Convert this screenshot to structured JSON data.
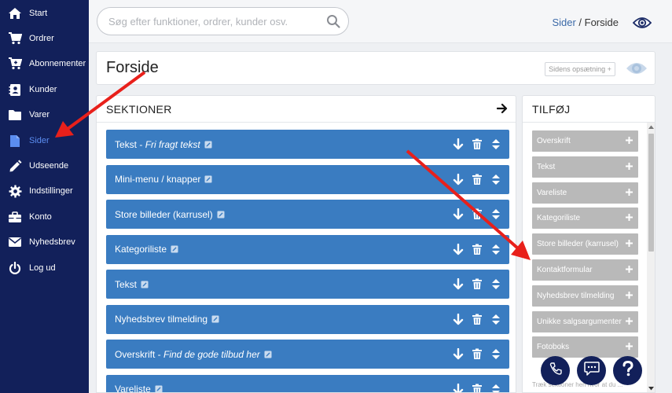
{
  "sidebar": {
    "items": [
      {
        "label": "Start",
        "icon": "home-icon"
      },
      {
        "label": "Ordrer",
        "icon": "cart-icon"
      },
      {
        "label": "Abonnementer",
        "icon": "cart-plus-icon"
      },
      {
        "label": "Kunder",
        "icon": "address-book-icon"
      },
      {
        "label": "Varer",
        "icon": "folder-icon"
      },
      {
        "label": "Sider",
        "icon": "file-icon",
        "active": true
      },
      {
        "label": "Udseende",
        "icon": "pencil-icon"
      },
      {
        "label": "Indstillinger",
        "icon": "gear-icon"
      },
      {
        "label": "Konto",
        "icon": "briefcase-icon"
      },
      {
        "label": "Nyhedsbrev",
        "icon": "envelope-icon"
      },
      {
        "label": "Log ud",
        "icon": "power-icon"
      }
    ]
  },
  "search": {
    "placeholder": "Søg efter funktioner, ordrer, kunder osv."
  },
  "breadcrumb": {
    "link": "Sider",
    "separator": " / ",
    "current": "Forside"
  },
  "page": {
    "title": "Forside",
    "setup_button": "Sidens opsætning +"
  },
  "sections": {
    "title": "SEKTIONER",
    "rows": [
      {
        "label": "Tekst",
        "detail": "Fri fragt tekst"
      },
      {
        "label": "Mini-menu / knapper",
        "detail": ""
      },
      {
        "label": "Store billeder (karrusel)",
        "detail": ""
      },
      {
        "label": "Kategoriliste",
        "detail": ""
      },
      {
        "label": "Tekst",
        "detail": ""
      },
      {
        "label": "Nyhedsbrev tilmelding",
        "detail": ""
      },
      {
        "label": "Overskrift",
        "detail": "Find de gode tilbud her"
      },
      {
        "label": "Vareliste",
        "detail": ""
      }
    ]
  },
  "add": {
    "title": "TILFØJ",
    "items": [
      "Overskrift",
      "Tekst",
      "Vareliste",
      "Kategoriliste",
      "Store billeder (karrusel)",
      "Kontaktformular",
      "Nyhedsbrev tilmelding",
      "Unikke salgsargumenter",
      "Fotoboks"
    ],
    "hint": "Træk sektioner hen hvor at du ..."
  },
  "colors": {
    "sidebar": "#12205a",
    "section_row": "#3a7cc1",
    "add_item": "#b9b9b9",
    "active_nav": "#5b8df0",
    "annotation_arrow": "#e8201b"
  }
}
